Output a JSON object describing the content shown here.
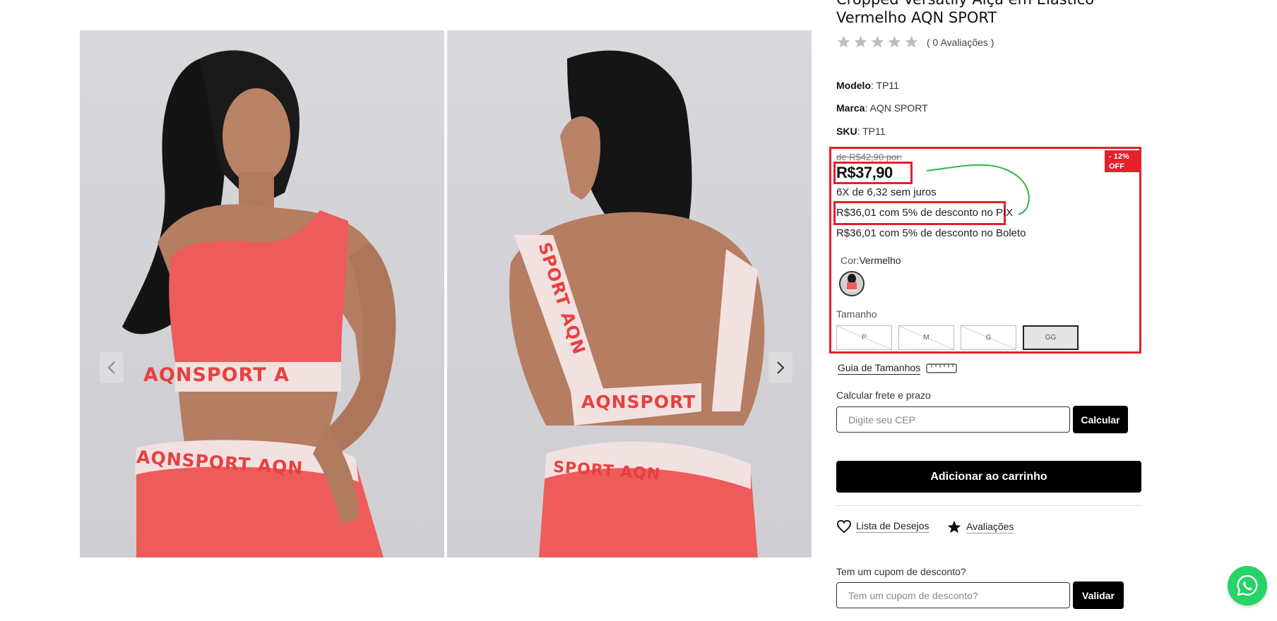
{
  "product": {
    "title": "Cropped Versatily Alça em Elástico Vermelho AQN SPORT",
    "rating_count_text": "( 0 Avaliações )",
    "stars": 5,
    "rating_value": 0,
    "modelo_label": "Modelo",
    "modelo_value": ": TP11",
    "marca_label": "Marca",
    "marca_value": ": AQN SPORT",
    "sku_label": "SKU",
    "sku_value": ": TP11"
  },
  "price": {
    "old": "de R$42,90 por:",
    "current": "R$37,90",
    "discount_badge_line1": "- 12%",
    "discount_badge_line2": "OFF",
    "installments": "6X de 6,32 sem juros",
    "pix": "R$36,01 com 5% de desconto no PIX",
    "boleto": "R$36,01 com 5% de desconto no Boleto"
  },
  "variants": {
    "color_label": "Cor:",
    "color_value": "Vermelho",
    "size_label": "Tamanho",
    "sizes": [
      {
        "label": "P",
        "available": false
      },
      {
        "label": "M",
        "available": false
      },
      {
        "label": "G",
        "available": false
      },
      {
        "label": "GG",
        "available": true,
        "selected": true
      }
    ]
  },
  "size_guide": {
    "label": "Guia de Tamanhos"
  },
  "shipping": {
    "label": "Calcular frete e prazo",
    "placeholder": "Digite seu CEP",
    "button": "Calcular"
  },
  "cart": {
    "button": "Adicionar ao carrinho"
  },
  "links": {
    "wishlist": "Lista de Desejos",
    "reviews": "Avaliações"
  },
  "coupon": {
    "label": "Tem um cupom de desconto?",
    "placeholder": "Tem um cupom de desconto?",
    "button": "Validar"
  },
  "gallery": {
    "band_texts": [
      "SPORT AQN",
      "AQNSPORT A",
      "AQNSPORT AQN",
      "AQNSPORT",
      "SPORT AQN",
      "AQN",
      "AQNSPORT",
      "SPORT AQN",
      "AQN",
      "AQN",
      "AQN"
    ]
  },
  "colors": {
    "highlight_red": "#e5202a",
    "garment_red": "#ee5b5b",
    "whatsapp_green": "#25d366",
    "annotation_green": "#2db84a"
  },
  "icons": [
    "chevron-left-icon",
    "chevron-right-icon",
    "star-icon",
    "heart-icon",
    "ruler-icon",
    "whatsapp-icon"
  ]
}
